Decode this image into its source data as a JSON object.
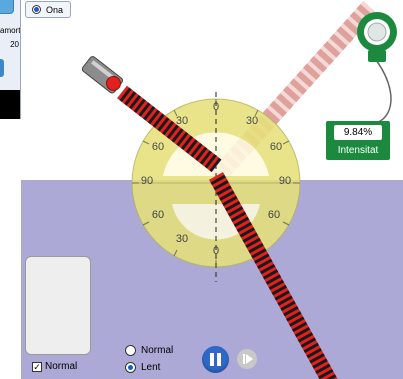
{
  "panel": {
    "amortiment_label": "amort",
    "amortiment_value": "20"
  },
  "wave_option": {
    "label": "Ona",
    "selected": true
  },
  "sensor": {
    "value": "9.84%",
    "label": "Intensitat"
  },
  "protractor": {
    "labels": [
      "30",
      "30",
      "60",
      "60",
      "90",
      "90",
      "60",
      "60",
      "30",
      "30",
      "0",
      "0"
    ]
  },
  "controls": {
    "normal_checkbox_label": "Normal",
    "normal_checked": true,
    "speed_normal_label": "Normal",
    "speed_slow_label": "Lent",
    "speed_selected": "Lent"
  },
  "colors": {
    "medium": "#aca9d6",
    "beam_dark": "#1a1a1a",
    "beam_red": "#e2201e",
    "reflected": "#d9908a",
    "protractor": "#e6e07a",
    "sensor": "#1c8a3e"
  }
}
